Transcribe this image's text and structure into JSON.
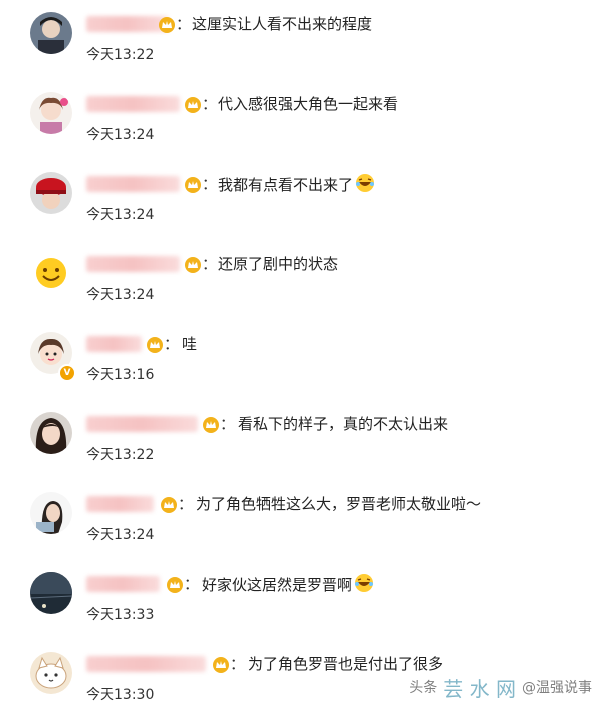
{
  "comments": [
    {
      "text": "这厘实让人看不出来的程度",
      "time": "今天13:22"
    },
    {
      "text": "代入感很强大角色一起来看",
      "time": "今天13:24"
    },
    {
      "text": "我都有点看不出来了",
      "time": "今天13:24",
      "emoji": "laugh-emoji"
    },
    {
      "text": "还原了剧中的状态",
      "time": "今天13:24"
    },
    {
      "text": "哇",
      "time": "今天13:16",
      "verified": true
    },
    {
      "text": "看私下的样子，真的不太认出来",
      "time": "今天13:22"
    },
    {
      "text": "为了角色牺牲这么大，罗晋老师太敬业啦～",
      "time": "今天13:24"
    },
    {
      "text": "好家伙这居然是罗晋啊",
      "time": "今天13:33",
      "emoji": "laugh-emoji"
    },
    {
      "text": "为了角色罗晋也是付出了很多",
      "time": "今天13:30"
    }
  ],
  "colon": "：",
  "verified_badge": "V",
  "watermark": {
    "site": "芸 水 网",
    "tag": "头条",
    "user": "@温强说事"
  },
  "colors": {
    "crown": "#f3b21b",
    "name_blur": "#f4b8b8",
    "time": "#333333"
  }
}
